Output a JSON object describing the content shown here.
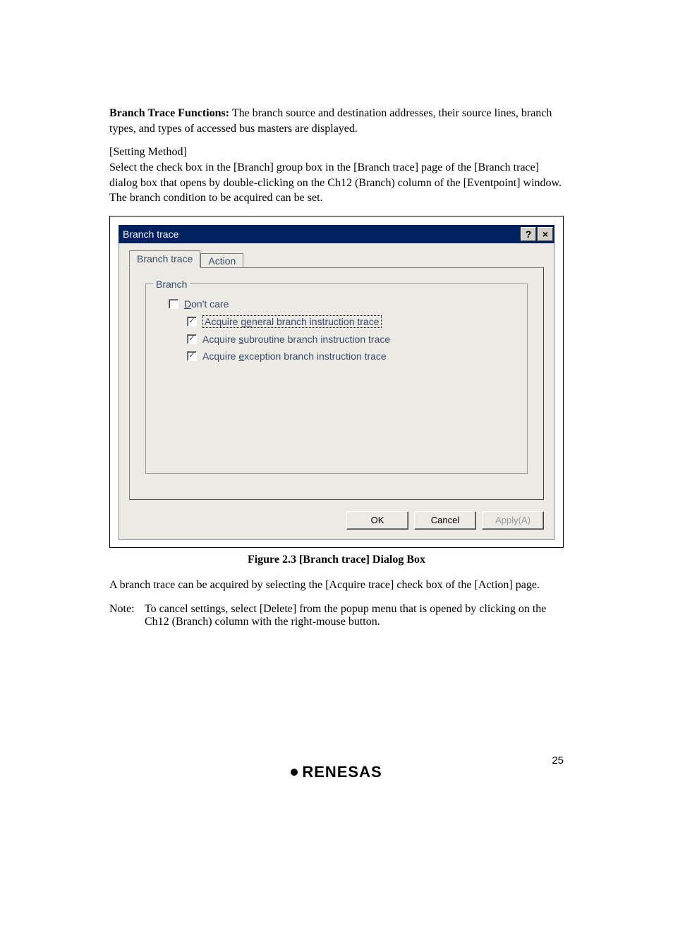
{
  "intro": {
    "heading": "Branch Trace Functions:",
    "text": " The branch source and destination addresses, their source lines, branch types, and types of accessed bus masters are displayed."
  },
  "setting_method": {
    "label": "[Setting Method]",
    "text": "Select the check box in the [Branch] group box in the [Branch trace] page of the [Branch trace] dialog box that opens by double-clicking on the Ch12 (Branch) column of the [Eventpoint] window. The branch condition to be acquired can be set."
  },
  "dialog": {
    "title": "Branch trace",
    "help_glyph": "?",
    "close_glyph": "×",
    "tabs": {
      "branch_trace": "Branch trace",
      "action": "Action"
    },
    "group_legend": "Branch",
    "checks": {
      "dont_care_pre": "D",
      "dont_care_rest": "on't care",
      "general_pre": "Acquire g",
      "general_ul": "e",
      "general_rest": "neral branch instruction trace",
      "sub_pre": "Acquire ",
      "sub_ul": "s",
      "sub_rest": "ubroutine branch instruction trace",
      "exc_pre": "Acquire ",
      "exc_ul": "e",
      "exc_rest": "xception branch instruction trace",
      "check_glyph": "✓"
    },
    "buttons": {
      "ok": "OK",
      "cancel": "Cancel",
      "apply": "Apply(A)"
    }
  },
  "caption": "Figure 2.3   [Branch trace] Dialog Box",
  "post_text": "A branch trace can be acquired by selecting the [Acquire trace] check box of the [Action] page.",
  "note": {
    "label": "Note:",
    "text": "To cancel settings, select [Delete] from the popup menu that is opened by clicking on the Ch12 (Branch) column with the right-mouse button."
  },
  "footer_brand": "RENESAS",
  "page_num": "25"
}
